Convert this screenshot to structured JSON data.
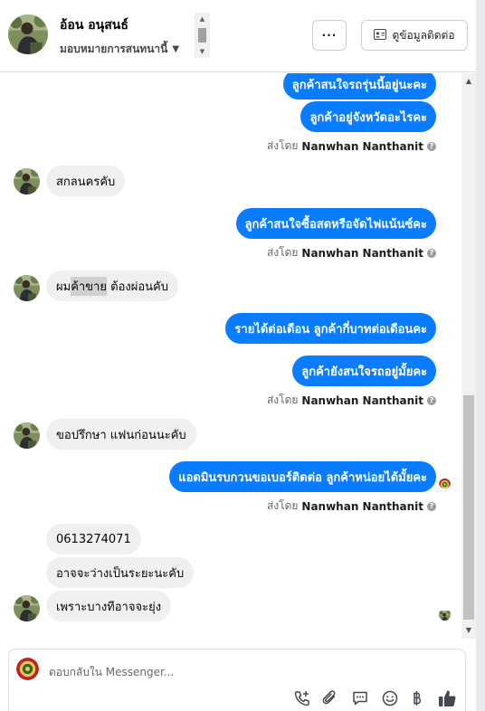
{
  "header": {
    "contact_name": "อ้อน อนุสนธ์",
    "assign_label": "มอบหมายการสนทนานี้",
    "more_label": "···",
    "contact_info_label": "ดูข้อมูลติดต่อ"
  },
  "messages": [
    {
      "side": "out",
      "text": "ลูกค้าสนใจรถรุ่นนี้อยู่นะคะ"
    },
    {
      "side": "out",
      "text": "ลูกค้าอยู่จังหวัดอะไรคะ"
    },
    {
      "sent_by_prefix": "ส่งโดย",
      "sent_by_name": "Nanwhan Nanthanit"
    },
    {
      "side": "in",
      "text": "สกลนครคับ"
    },
    {
      "side": "out",
      "text": "ลูกค้าสนใจซื้อสดหรือจัดไฟแน้นซ์คะ"
    },
    {
      "sent_by_prefix": "ส่งโดย",
      "sent_by_name": "Nanwhan Nanthanit"
    },
    {
      "side": "in",
      "text_before": "ผม",
      "text_highlight": "ค้าขาย",
      "text_after": " ต้องผ่อนคับ"
    },
    {
      "side": "out",
      "text": "รายได้ต่อเดือน ลูกค้ากี่บาทต่อเดือนคะ"
    },
    {
      "side": "out",
      "text": "ลูกค้ายังสนใจรถอยู่มั้ยคะ"
    },
    {
      "sent_by_prefix": "ส่งโดย",
      "sent_by_name": "Nanwhan Nanthanit"
    },
    {
      "side": "in",
      "text": "ขอปรึกษา แฟนก่อนนะคับ"
    },
    {
      "side": "out",
      "text": "แอดมินรบกวนขอเบอร์ติดต่อ ลูกค้าหน่อยได้มั้ยคะ"
    },
    {
      "sent_by_prefix": "ส่งโดย",
      "sent_by_name": "Nanwhan Nanthanit"
    },
    {
      "side": "in",
      "text": "0613274071"
    },
    {
      "side": "in",
      "text": "อาจจะว่างเป็นระยะนะคับ"
    },
    {
      "side": "in",
      "text": "เพราะบางทีอาจจะยุ่ง"
    }
  ],
  "composer": {
    "placeholder": "ตอบกลับใน Messenger...",
    "tools": [
      "phone-plus-icon",
      "paperclip-icon",
      "saved-reply-icon",
      "emoji-icon",
      "currency-icon",
      "thumbs-up-icon"
    ]
  },
  "colors": {
    "outgoing_bubble": "#0a7cff",
    "incoming_bubble": "#f0f0f0",
    "secondary_text": "#65676b"
  }
}
